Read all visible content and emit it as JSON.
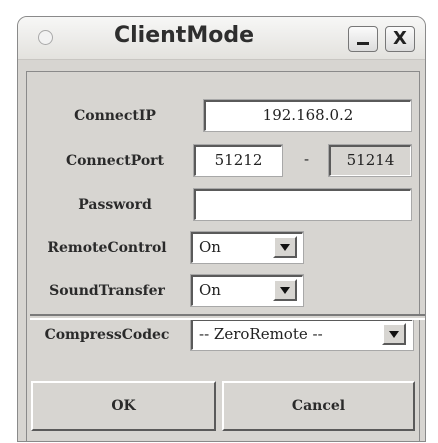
{
  "window": {
    "title": "ClientMode",
    "minimize_label": "_",
    "close_label": "X"
  },
  "form": {
    "connect_ip": {
      "label": "ConnectIP",
      "value": "192.168.0.2"
    },
    "connect_port": {
      "label": "ConnectPort",
      "from": "51212",
      "separator": "-",
      "to": "51214"
    },
    "password": {
      "label": "Password",
      "value": ""
    },
    "remote_control": {
      "label": "RemoteControl",
      "selected": "On"
    },
    "sound_transfer": {
      "label": "SoundTransfer",
      "selected": "On"
    },
    "compress_codec": {
      "label": "CompressCodec",
      "selected": "-- ZeroRemote --"
    }
  },
  "buttons": {
    "ok": "OK",
    "cancel": "Cancel"
  }
}
